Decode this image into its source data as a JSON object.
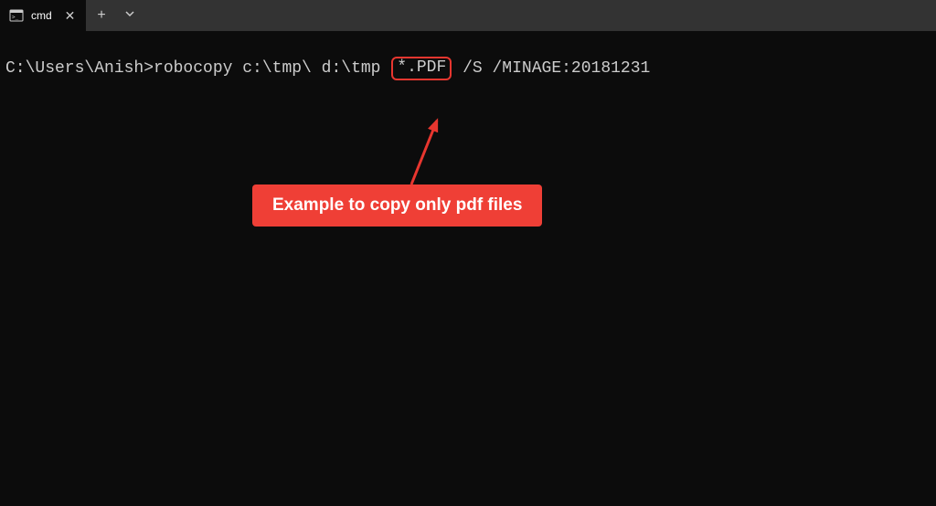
{
  "tabs": {
    "active": {
      "title": "cmd"
    }
  },
  "terminal": {
    "prompt": "C:\\Users\\Anish>",
    "command_part1": "robocopy c:\\tmp\\ d:\\tmp ",
    "command_highlight": "*.PDF",
    "command_part2": " /S /MINAGE:20181231"
  },
  "annotation": {
    "callout_text": "Example to copy only pdf files"
  }
}
